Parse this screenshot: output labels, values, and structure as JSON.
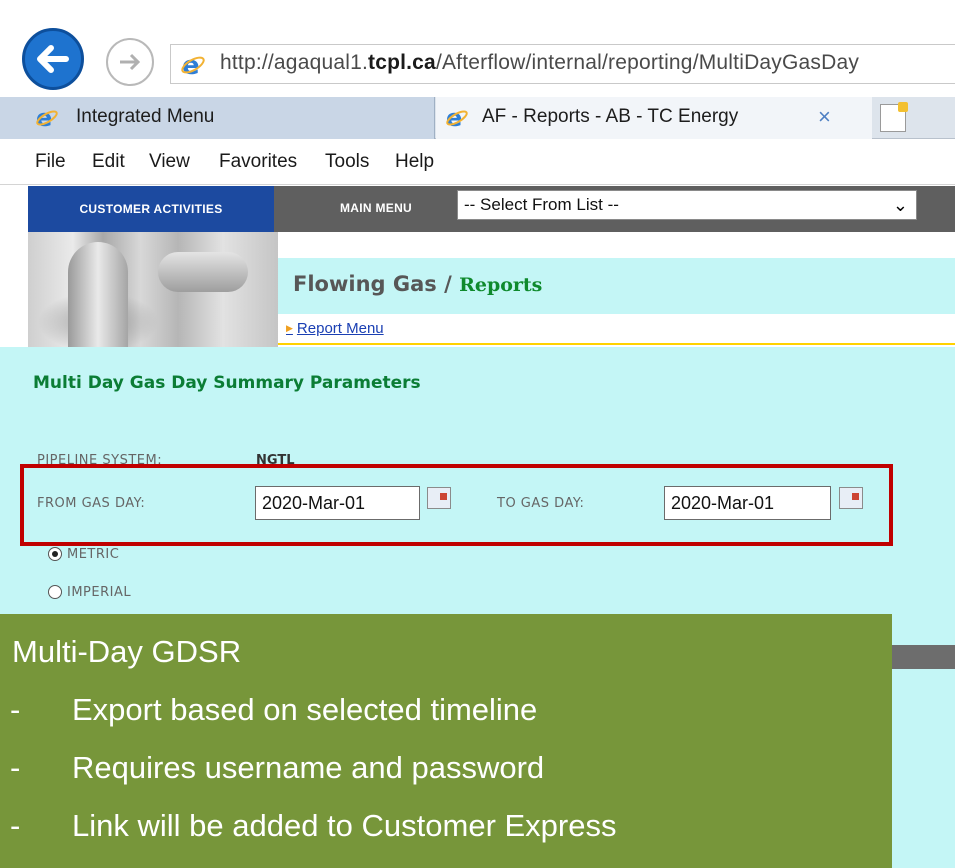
{
  "browser": {
    "url_prefix": "http://agaqual1.",
    "url_domain": "tcpl.ca",
    "url_path": "/Afterflow/internal/reporting/MultiDayGasDay",
    "tabs": [
      {
        "label": "Integrated Menu"
      },
      {
        "label": "AF - Reports - AB - TC Energy",
        "close": "×"
      }
    ],
    "menu": [
      "File",
      "Edit",
      "View",
      "Favorites",
      "Tools",
      "Help"
    ]
  },
  "app": {
    "customer_activities": "CUSTOMER ACTIVITIES",
    "main_menu_label": "MAIN MENU",
    "main_menu_select": "-- Select From List --",
    "title_main": "Flowing Gas / ",
    "title_sub": "Reports",
    "report_menu_link": "Report Menu",
    "params_title": "Multi Day Gas Day Summary Parameters",
    "pipeline_label": "PIPELINE SYSTEM:",
    "pipeline_value": "NGTL",
    "from_label": "FROM GAS DAY:",
    "from_value": "2020-Mar-01",
    "to_label": "TO GAS DAY:",
    "to_value": "2020-Mar-01",
    "unit_options": [
      {
        "label": "METRIC",
        "selected": true
      },
      {
        "label": "IMPERIAL",
        "selected": false
      }
    ]
  },
  "callout": {
    "title": "Multi-Day GDSR",
    "bullets": [
      "Export based on selected timeline",
      "Requires username and password",
      "Link will be added to Customer Express"
    ],
    "dash": "-"
  },
  "colors": {
    "accent_blue": "#1c4aa0",
    "content_cyan": "#c4f6f6",
    "highlight_red": "#c00000",
    "callout_green": "#77963a",
    "reports_green": "#0f8a2d"
  }
}
